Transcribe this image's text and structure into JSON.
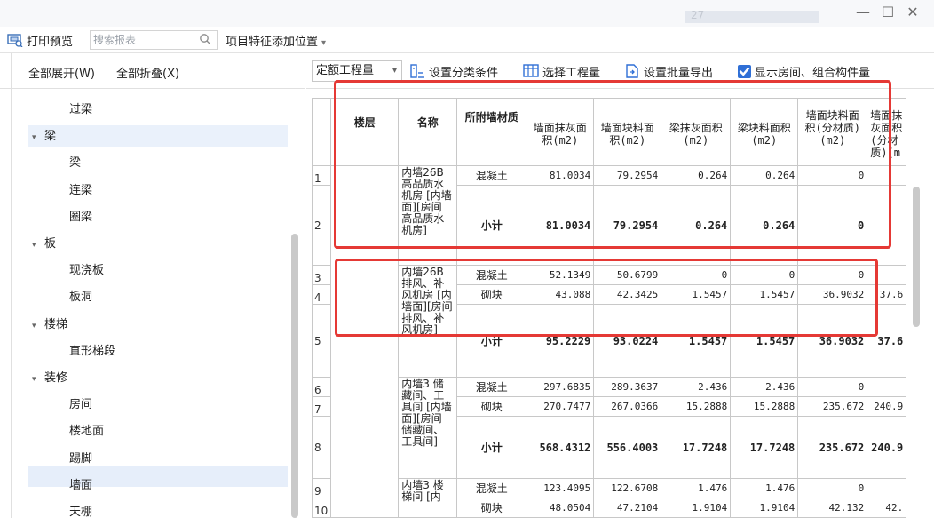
{
  "titlebar": {
    "ghost_text": "27",
    "minimize": "—",
    "maximize": "☐",
    "close": "✕"
  },
  "toolbar": {
    "print_preview": "打印预览",
    "search_placeholder": "搜索报表",
    "feature_position": "项目特征添加位置"
  },
  "left_panel": {
    "expand_all": "全部展开(W)",
    "collapse_all": "全部折叠(X)",
    "tree": [
      {
        "label": "过梁",
        "level": 2
      },
      {
        "label": "梁",
        "level": 1,
        "expanded": true
      },
      {
        "label": "梁",
        "level": 2
      },
      {
        "label": "连梁",
        "level": 2
      },
      {
        "label": "圈梁",
        "level": 2
      },
      {
        "label": "板",
        "level": 1,
        "expanded": true
      },
      {
        "label": "现浇板",
        "level": 2
      },
      {
        "label": "板洞",
        "level": 2
      },
      {
        "label": "楼梯",
        "level": 1,
        "expanded": true
      },
      {
        "label": "直形梯段",
        "level": 2
      },
      {
        "label": "装修",
        "level": 1,
        "expanded": true
      },
      {
        "label": "房间",
        "level": 2
      },
      {
        "label": "楼地面",
        "level": 2
      },
      {
        "label": "踢脚",
        "level": 2
      },
      {
        "label": "墙面",
        "level": 2,
        "selected": true
      },
      {
        "label": "天棚",
        "level": 2
      }
    ]
  },
  "report_toolbar": {
    "quantity_type": "定额工程量",
    "set_classification": "设置分类条件",
    "select_quantity": "选择工程量",
    "batch_export": "设置批量导出",
    "show_rooms": "显示房间、组合构件量",
    "show_rooms_checked": true
  },
  "table": {
    "headers": [
      "楼层",
      "名称",
      "所附墙材质",
      "墙面抹灰面积(m2)",
      "墙面块料面积(m2)",
      "梁抹灰面积(m2)",
      "梁块料面积(m2)",
      "墙面块料面积(分材质)(m2)",
      "墙面抹灰面积(分材质)(m"
    ],
    "names": {
      "g1": "内墙26B 高品质水机房 [内墙面][房间 高品质水机房]",
      "g2": "内墙26B 排风、补风机房 [内墙面][房间 排风、补风机房]",
      "g3": "内墙3 储藏间、工具间 [内墙面][房间 储藏间、工具间]",
      "g4": "内墙3 楼梯间 [内"
    },
    "rows": [
      {
        "n": "1",
        "mat": "混凝土",
        "v": [
          "81.0034",
          "79.2954",
          "0.264",
          "0.264",
          "0",
          ""
        ]
      },
      {
        "n": "2",
        "mat": "小计",
        "v": [
          "81.0034",
          "79.2954",
          "0.264",
          "0.264",
          "0",
          ""
        ]
      },
      {
        "n": "3",
        "mat": "混凝土",
        "v": [
          "52.1349",
          "50.6799",
          "0",
          "0",
          "0",
          ""
        ]
      },
      {
        "n": "4",
        "mat": "砌块",
        "v": [
          "43.088",
          "42.3425",
          "1.5457",
          "1.5457",
          "36.9032",
          "37.6"
        ]
      },
      {
        "n": "5",
        "mat": "小计",
        "v": [
          "95.2229",
          "93.0224",
          "1.5457",
          "1.5457",
          "36.9032",
          "37.6"
        ]
      },
      {
        "n": "6",
        "mat": "混凝土",
        "v": [
          "297.6835",
          "289.3637",
          "2.436",
          "2.436",
          "0",
          ""
        ]
      },
      {
        "n": "7",
        "mat": "砌块",
        "v": [
          "270.7477",
          "267.0366",
          "15.2888",
          "15.2888",
          "235.672",
          "240.9"
        ]
      },
      {
        "n": "8",
        "mat": "小计",
        "v": [
          "568.4312",
          "556.4003",
          "17.7248",
          "17.7248",
          "235.672",
          "240.9"
        ]
      },
      {
        "n": "9",
        "mat": "混凝土",
        "v": [
          "123.4095",
          "122.6708",
          "1.476",
          "1.476",
          "0",
          ""
        ]
      },
      {
        "n": "10",
        "mat": "砌块",
        "v": [
          "48.0504",
          "47.2104",
          "1.9104",
          "1.9104",
          "42.132",
          "42."
        ]
      }
    ]
  }
}
